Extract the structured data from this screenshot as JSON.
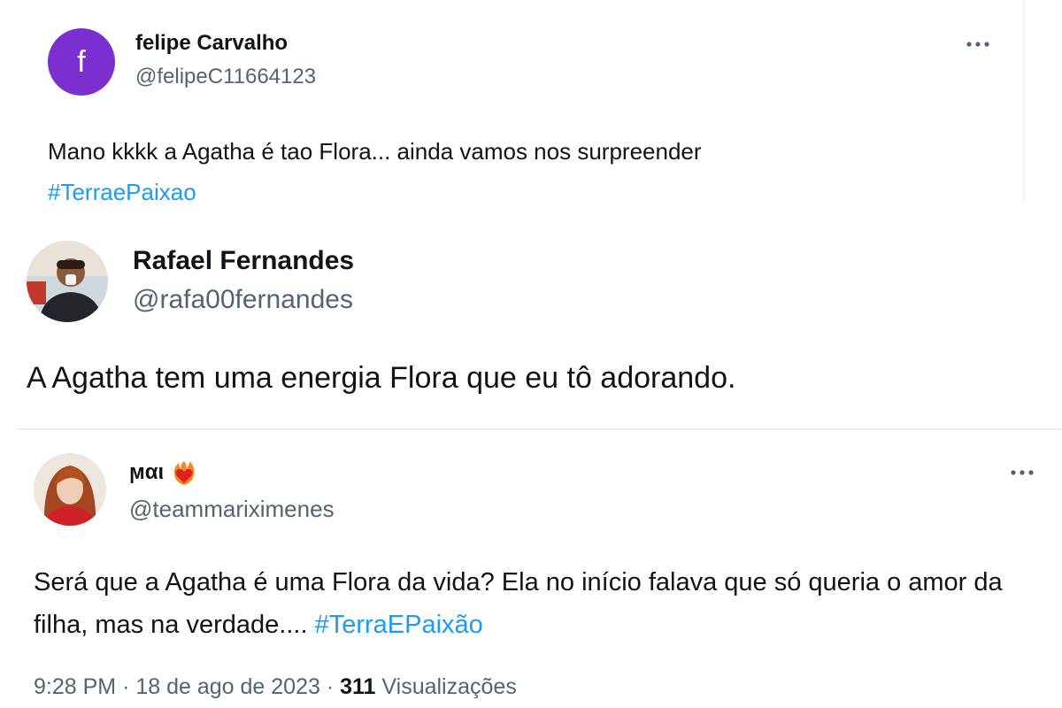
{
  "tweets": [
    {
      "avatar_letter": "f",
      "avatar_color": "#7b2fd0",
      "name": "felipe Carvalho",
      "handle": "@felipeC11664123",
      "more_icon": "more-horizontal-icon",
      "text": "Mano kkkk a Agatha é tao Flora... ainda vamos nos surpreender",
      "hashtag": "#TerraePaixao"
    },
    {
      "avatar_icon": "user-photo-avatar",
      "name": "Rafael Fernandes",
      "handle": "@rafa00fernandes",
      "text": "A Agatha tem uma energia Flora que eu tô adorando."
    },
    {
      "avatar_icon": "user-photo-avatar",
      "name": "ϻαι",
      "name_emoji_icon": "heart-on-fire-emoji-icon",
      "handle": "@teammariximenes",
      "more_icon": "more-horizontal-icon",
      "text": "Será que a Agatha é uma Flora da vida? Ela no início falava que só queria o amor da filha, mas na verdade.... ",
      "hashtag": "#TerraEPaixão",
      "time": "9:28 PM",
      "separator": "·",
      "date": "18 de ago de 2023",
      "views_count": "311",
      "views_label": "Visualizações"
    }
  ],
  "colors": {
    "text": "#0f1419",
    "secondary": "#536471",
    "link": "#1d9bf0",
    "divider": "#e6ecf0"
  }
}
